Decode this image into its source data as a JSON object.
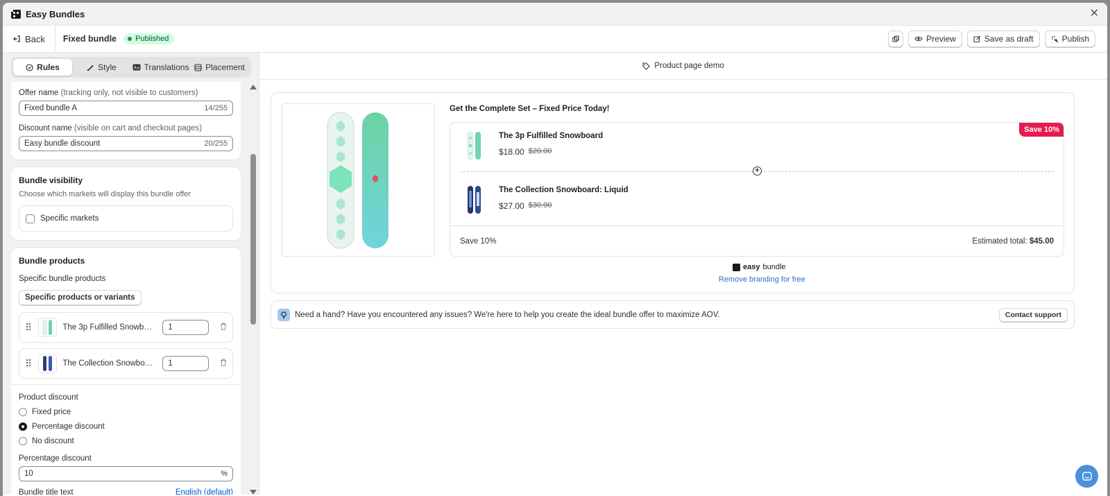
{
  "window": {
    "title": "Easy Bundles"
  },
  "topbar": {
    "back_label": "Back",
    "bundle_name": "Fixed bundle",
    "status": "Published",
    "preview_label": "Preview",
    "save_draft_label": "Save as draft",
    "publish_label": "Publish"
  },
  "tabs": [
    {
      "label": "Rules",
      "icon": "rules-icon"
    },
    {
      "label": "Style",
      "icon": "brush-icon"
    },
    {
      "label": "Translations",
      "icon": "translate-icon"
    },
    {
      "label": "Placement",
      "icon": "placement-icon"
    }
  ],
  "offer": {
    "offer_name_label": "Offer name",
    "offer_name_hint": "(tracking only, not visible to customers)",
    "offer_name_value": "Fixed bundle A",
    "offer_name_count": "14/255",
    "discount_name_label": "Discount name",
    "discount_name_hint": "(visible on cart and checkout pages)",
    "discount_name_value": "Easy bundle discount",
    "discount_name_count": "20/255"
  },
  "visibility": {
    "title": "Bundle visibility",
    "subtitle": "Choose which markets will display this bundle offer",
    "checkbox_label": "Specific markets"
  },
  "bundle_products": {
    "title": "Bundle products",
    "subtitle": "Specific bundle products",
    "button_label": "Specific products or variants",
    "items": [
      {
        "name": "The 3p Fulfilled Snowboard",
        "qty": "1"
      },
      {
        "name": "The Collection Snowboard: Liquid",
        "qty": "1"
      }
    ],
    "discount_label": "Product discount",
    "options": [
      "Fixed price",
      "Percentage discount",
      "No discount"
    ],
    "percentage_label": "Percentage discount",
    "percentage_value": "10",
    "percentage_suffix": "%",
    "title_text_label": "Bundle title text",
    "language_link": "English (default)"
  },
  "preview": {
    "header": "Product page demo",
    "offer_title": "Get the Complete Set – Fixed Price Today!",
    "save_tag": "Save 10%",
    "items": [
      {
        "name": "The 3p Fulfilled Snowboard",
        "price": "$18.00",
        "compare": "$20.00"
      },
      {
        "name": "The Collection Snowboard: Liquid",
        "price": "$27.00",
        "compare": "$30.00"
      }
    ],
    "footer_save": "Save 10%",
    "total_label": "Estimated total:",
    "total_value": "$45.00",
    "brand_bold": "easy",
    "brand_rest": "bundle",
    "remove_branding": "Remove branding for free"
  },
  "help": {
    "text": "Need a hand? Have you encountered any issues? We're here to help you create the ideal bundle offer to maximize AOV.",
    "button": "Contact support"
  },
  "colors": {
    "accent_red": "#e51c4d",
    "published_bg": "#cdfee1",
    "link_blue": "#2c6ecb",
    "chat_blue": "#4d8fdb"
  }
}
